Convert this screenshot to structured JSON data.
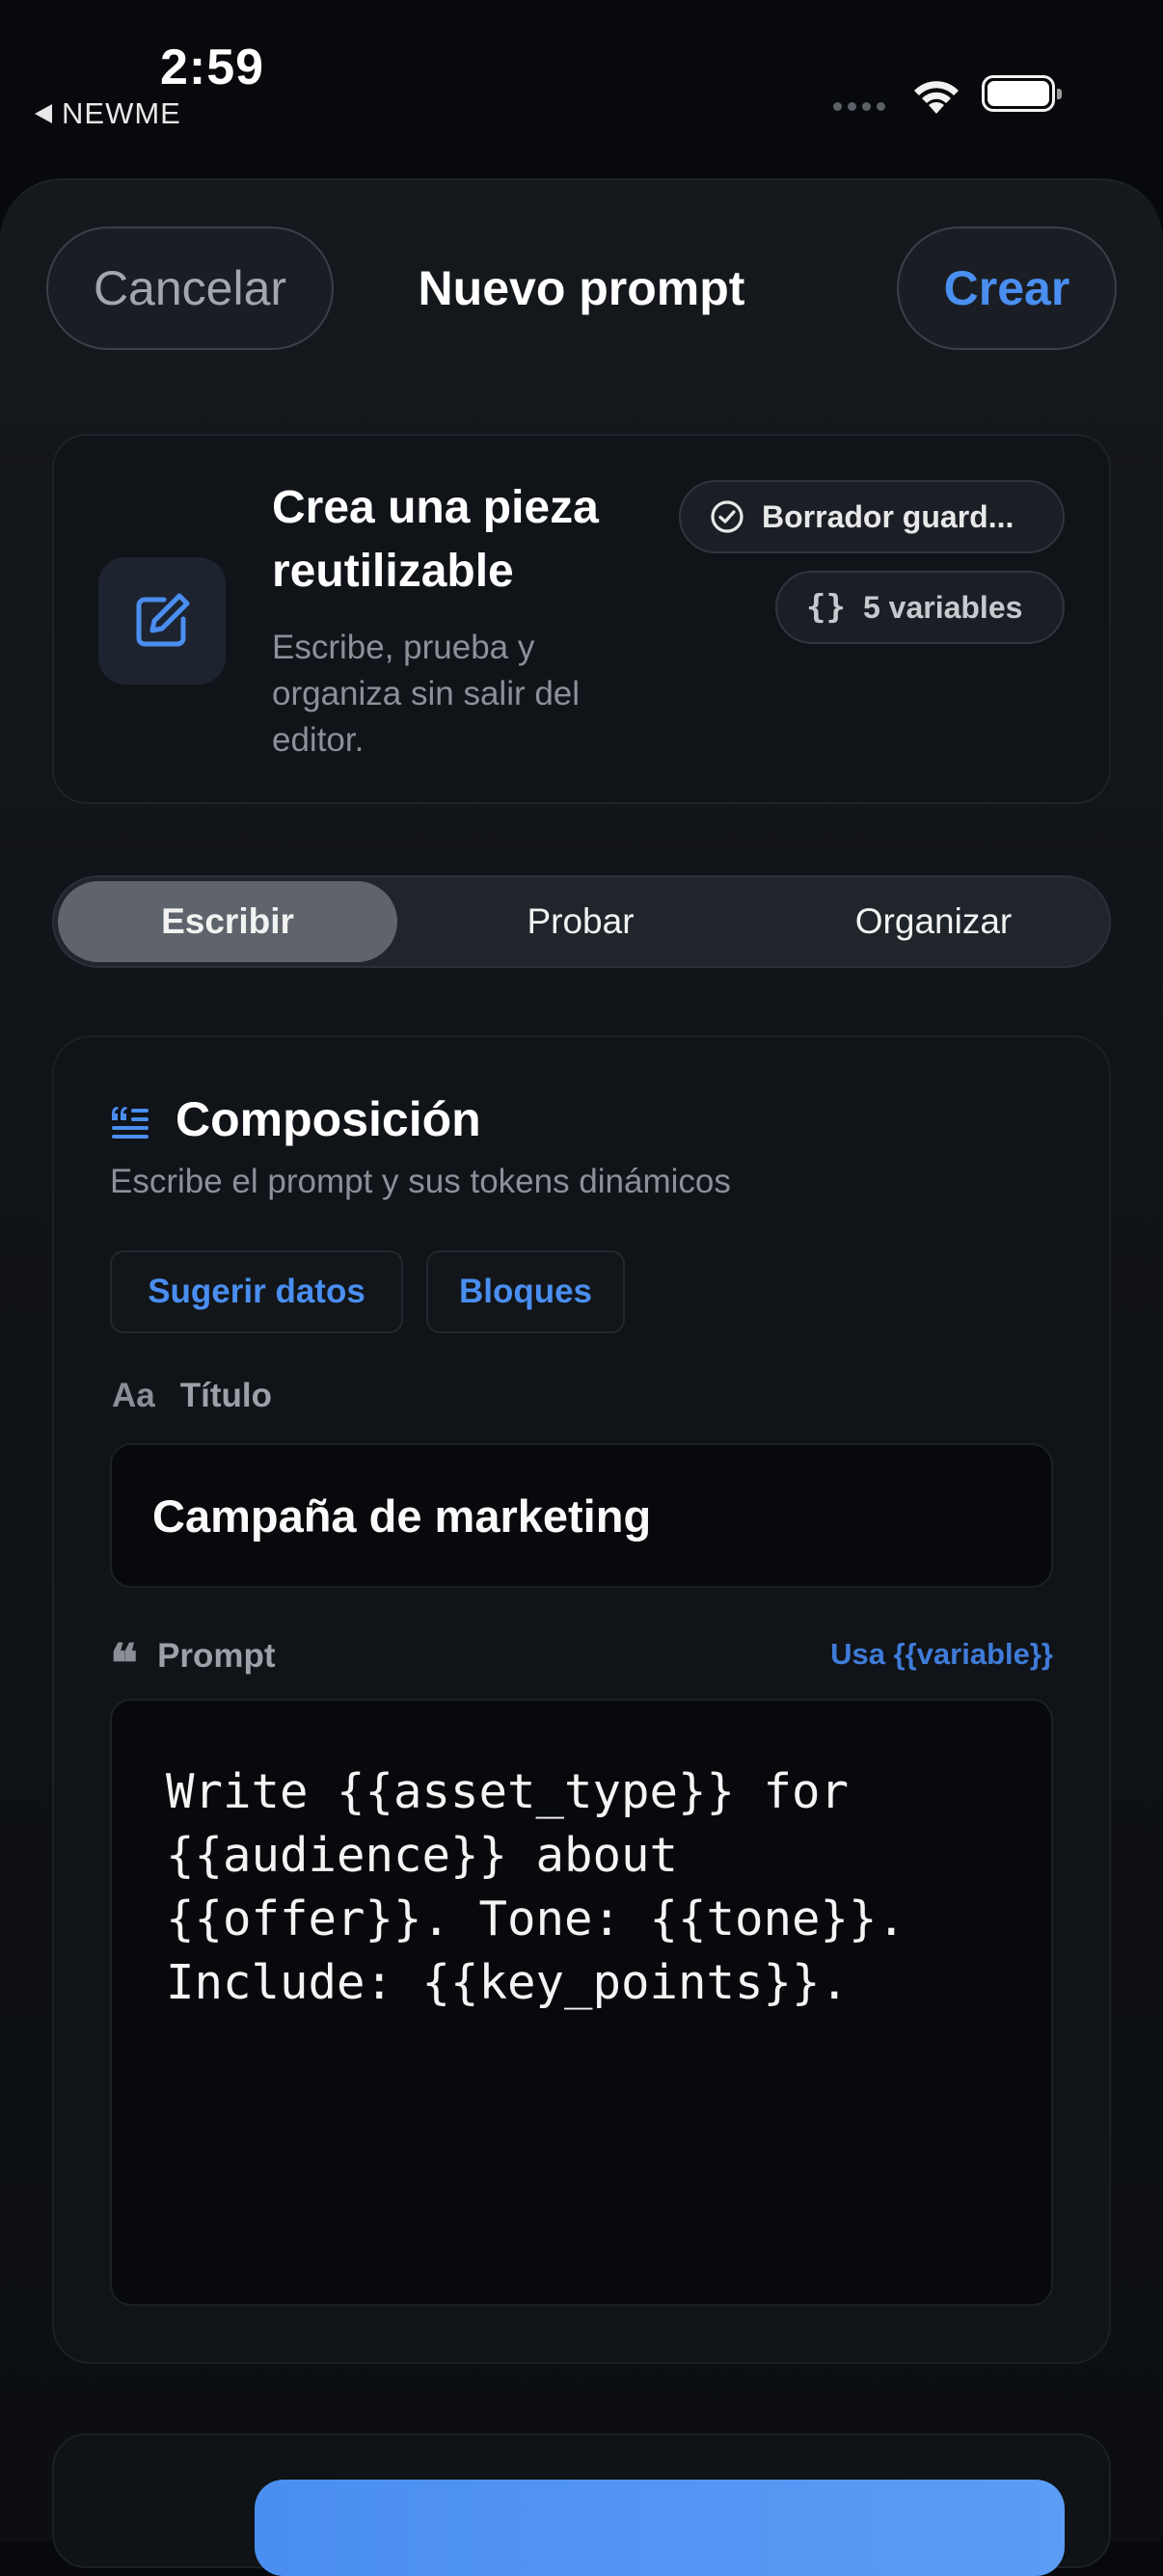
{
  "status_bar": {
    "time": "2:59",
    "back_app": "NEWME"
  },
  "nav": {
    "cancel_label": "Cancelar",
    "title": "Nuevo prompt",
    "create_label": "Crear"
  },
  "hero": {
    "title": "Crea una pieza reutilizable",
    "subtitle": "Escribe, prueba y organiza sin salir del editor.",
    "draft_chip": "Borrador guard...",
    "vars_icon": "{}",
    "vars_chip": "5 variables"
  },
  "tabs": [
    {
      "label": "Escribir",
      "active": true
    },
    {
      "label": "Probar",
      "active": false
    },
    {
      "label": "Organizar",
      "active": false
    }
  ],
  "composition": {
    "title": "Composición",
    "subtitle": "Escribe el prompt y sus tokens dinámicos",
    "suggest_label": "Sugerir datos",
    "blocks_label": "Bloques",
    "title_field": {
      "icon_text": "Aa",
      "label": "Título",
      "value": "Campaña de marketing"
    },
    "prompt_field": {
      "label": "Prompt",
      "hint": "Usa {{variable}}",
      "value": "Write {{asset_type}} for\n{{audience}} about\n{{offer}}. Tone: {{tone}}.\nInclude: {{key_points}}."
    }
  },
  "colors": {
    "accent": "#4a8ef0",
    "background": "#07090c",
    "card": "#101318"
  }
}
